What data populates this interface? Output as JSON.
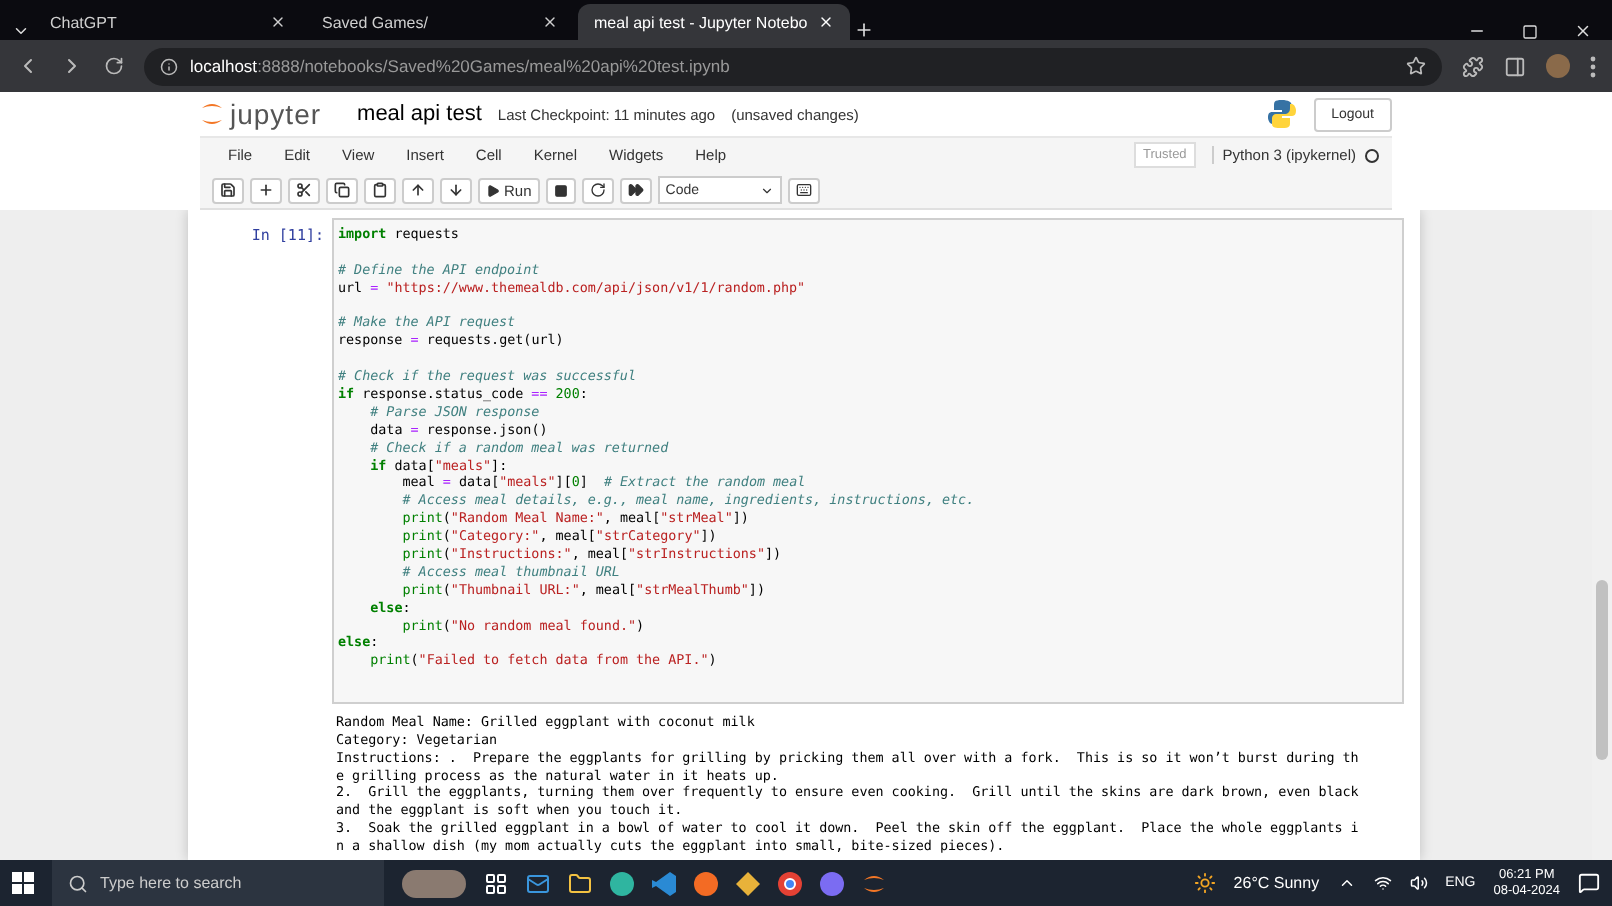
{
  "browser": {
    "tabs": [
      {
        "title": "ChatGPT",
        "selected": false
      },
      {
        "title": "Saved Games/",
        "selected": false
      },
      {
        "title": "meal api test - Jupyter Notebo",
        "selected": true
      }
    ],
    "address": {
      "host": "localhost",
      "path": ":8888/notebooks/Saved%20Games/meal%20api%20test.ipynb"
    }
  },
  "notebook": {
    "logo": "jupyter",
    "title": "meal api test",
    "checkpoint": "Last Checkpoint: 11 minutes ago",
    "status": "(unsaved changes)",
    "logout": "Logout",
    "menu": [
      "File",
      "Edit",
      "View",
      "Insert",
      "Cell",
      "Kernel",
      "Widgets",
      "Help"
    ],
    "trusted": "Trusted",
    "kernel": "Python 3 (ipykernel)",
    "run_label": "Run",
    "cell_type": "Code",
    "cell": {
      "prompt": "In [11]:",
      "code_blocks": [
        [
          "import requests"
        ],
        [
          "# Define the API endpoint",
          "url = \"https://www.themealdb.com/api/json/v1/1/random.php\""
        ],
        [
          "# Make the API request",
          "response = requests.get(url)"
        ],
        [
          "# Check if the request was successful",
          "if response.status_code == 200:",
          "    # Parse JSON response",
          "    data = response.json()",
          "    # Check if a random meal was returned",
          "    if data[\"meals\"]:",
          "        meal = data[\"meals\"][0]  # Extract the random meal",
          "        # Access meal details, e.g., meal name, ingredients, instructions, etc.",
          "        print(\"Random Meal Name:\", meal[\"strMeal\"])",
          "        print(\"Category:\", meal[\"strCategory\"])",
          "        print(\"Instructions:\", meal[\"strInstructions\"])",
          "        # Access meal thumbnail URL",
          "        print(\"Thumbnail URL:\", meal[\"strMealThumb\"])",
          "    else:",
          "        print(\"No random meal found.\")",
          "else:",
          "    print(\"Failed to fetch data from the API.\")"
        ]
      ],
      "output": [
        "Random Meal Name: Grilled eggplant with coconut milk",
        "Category: Vegetarian",
        "Instructions: .  Prepare the eggplants for grilling by pricking them all over with a fork.  This is so it won’t burst during th",
        "e grilling process as the natural water in it heats up.",
        "2.  Grill the eggplants, turning them over frequently to ensure even cooking.  Grill until the skins are dark brown, even black",
        "and the eggplant is soft when you touch it.",
        "3.  Soak the grilled eggplant in a bowl of water to cool it down.  Peel the skin off the eggplant.  Place the whole eggplants i",
        "n a shallow dish (my mom actually cuts the eggplant into small, bite-sized pieces)."
      ]
    }
  },
  "taskbar": {
    "search": "Type here to search",
    "weather": "26°C Sunny",
    "language": "ENG",
    "time": "06:21 PM",
    "date": "08-04-2024"
  }
}
